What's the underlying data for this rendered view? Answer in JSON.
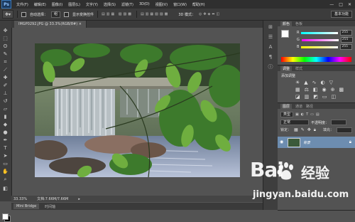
{
  "menubar": {
    "logo": "Ps",
    "items": [
      "文件(F)",
      "编辑(E)",
      "图像(I)",
      "图层(L)",
      "文字(Y)",
      "选择(S)",
      "滤镜(T)",
      "3D(D)",
      "视图(V)",
      "窗口(W)",
      "帮助(H)"
    ],
    "window_buttons": [
      "—",
      "□",
      "✕"
    ]
  },
  "options": {
    "auto_select_label": "自动选择：",
    "auto_select_value": "组",
    "transform_label": "显示变换控件",
    "mode_3d": "3D 模式：",
    "workspace": "基本功能"
  },
  "document": {
    "tab_title": "IMGP0292.JPG @ 33.3%(RGB/8#) ×"
  },
  "status": {
    "zoom": "33.33%",
    "doc_info": "文档:7.66M/7.66M"
  },
  "bottom_tabs": [
    "Mini Bridge",
    "时间轴"
  ],
  "color_panel": {
    "tabs": [
      "颜色",
      "色板"
    ],
    "channels": [
      {
        "label": "R",
        "value": "255"
      },
      {
        "label": "G",
        "value": "255"
      },
      {
        "label": "B",
        "value": "255"
      }
    ]
  },
  "adjust_panel": {
    "tabs": [
      "调整",
      "样式"
    ],
    "title": "添加调整"
  },
  "layers_panel": {
    "tabs": [
      "图层",
      "通道",
      "路径"
    ],
    "filter": "类型",
    "blend_mode": "正常",
    "opacity_label": "不透明度：",
    "lock_label": "锁定：",
    "fill_label": "填充：",
    "layer_name": "背景"
  },
  "watermark": {
    "brand_left": "Bai",
    "brand_mid": "du",
    "brand_cn": "经验",
    "url": "jingyan.baidu.com"
  },
  "colors": {
    "ui_dark": "#2f2f2f",
    "ui_panel": "#535353",
    "layer_selected": "#6d8db0"
  }
}
